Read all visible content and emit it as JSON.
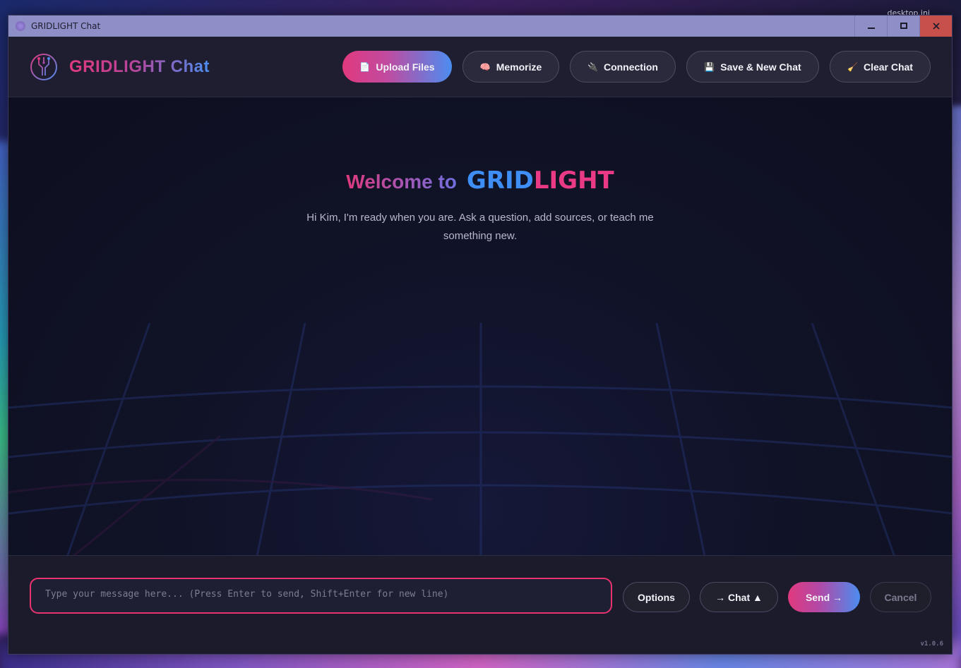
{
  "desktop": {
    "icon_label": "desktop.ini"
  },
  "window": {
    "title": "GRIDLIGHT Chat",
    "controls": {
      "minimize": "▁",
      "maximize": "▢",
      "close": "✕"
    }
  },
  "header": {
    "logo_text": "GRIDLIGHT Chat",
    "buttons": [
      {
        "label": "Upload Files",
        "icon": "📄",
        "icon_name": "document-icon"
      },
      {
        "label": "Memorize",
        "icon": "🧠",
        "icon_name": "brain-icon"
      },
      {
        "label": "Connection",
        "icon": "🔌",
        "icon_name": "plug-icon"
      },
      {
        "label": "Save & New Chat",
        "icon": "💾",
        "icon_name": "floppy-disk-icon"
      },
      {
        "label": "Clear Chat",
        "icon": "🧹",
        "icon_name": "broom-icon"
      }
    ]
  },
  "welcome": {
    "prefix": "Welcome to",
    "brand_part1": "GRID",
    "brand_part2": "LIGHT",
    "subtitle": "Hi Kim, I'm ready when you are. Ask a question, add sources, or teach me something new."
  },
  "composer": {
    "placeholder": "Type your message here... (Press Enter to send, Shift+Enter for new line)",
    "value": "",
    "options_label": "Options",
    "mode_label": "→ Chat ▲",
    "send_label": "Send →",
    "cancel_label": "Cancel"
  },
  "version": "v1.0.6",
  "colors": {
    "accent_pink": "#e0397e",
    "accent_blue": "#4b8df0",
    "background": "#1a1a2b",
    "input_border": "#e8336f"
  }
}
